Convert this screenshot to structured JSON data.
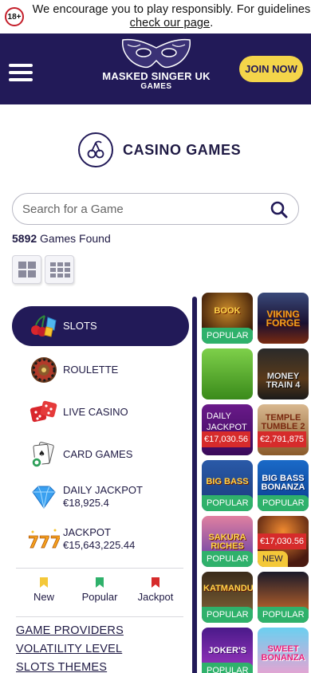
{
  "banner": {
    "age_badge": "18+",
    "text_line1": "We encourage you to play responsibly. For guidelines",
    "link_text": "check our page",
    "suffix": "."
  },
  "header": {
    "menu_icon": "hamburger-icon",
    "brand_line1": "MASKED SINGER UK",
    "brand_line2": "GAMES",
    "join_label": "JOIN NOW"
  },
  "title": {
    "icon": "cherries-icon",
    "text": "CASINO GAMES"
  },
  "search": {
    "placeholder": "Search for a Game",
    "value": "",
    "icon": "search-icon"
  },
  "games_found": {
    "count": "5892",
    "label": "Games Found"
  },
  "view_toggle": {
    "large_grid_icon": "grid-large-icon",
    "small_grid_icon": "grid-small-icon"
  },
  "categories": [
    {
      "label": "SLOTS",
      "icon": "slots-icon",
      "active": true
    },
    {
      "label": "ROULETTE",
      "icon": "roulette-icon",
      "active": false
    },
    {
      "label": "LIVE CASINO",
      "icon": "dice-icon",
      "active": false
    },
    {
      "label": "CARD GAMES",
      "icon": "cards-icon",
      "active": false
    },
    {
      "label": "DAILY JACKPOT",
      "amount": "€18,925.4",
      "icon": "diamond-icon",
      "active": false
    },
    {
      "label": "JACKPOT",
      "amount": "€15,643,225.44",
      "icon": "777-icon",
      "active": false
    }
  ],
  "filters": [
    {
      "label": "New",
      "color": "#f4c839"
    },
    {
      "label": "Popular",
      "color": "#2fb16b"
    },
    {
      "label": "Jackpot",
      "color": "#d62b2b"
    }
  ],
  "links": [
    "GAME PROVIDERS",
    "VOLATILITY LEVEL",
    "SLOTS THEMES"
  ],
  "games": [
    {
      "title": "BOOK",
      "badge": "POPULAR"
    },
    {
      "title": "VIKING FORGE",
      "badge": ""
    },
    {
      "title": "",
      "badge": ""
    },
    {
      "title": "MONEY TRAIN 4",
      "badge": ""
    },
    {
      "title": "DAILY JACKPOT",
      "badge": "",
      "amount": "€17,030.56"
    },
    {
      "title": "TEMPLE TUMBLE 2",
      "badge": "",
      "amount": "€2,791,875"
    },
    {
      "title": "BIG BASS",
      "badge": "POPULAR"
    },
    {
      "title": "BIG BASS BONANZA",
      "badge": "POPULAR"
    },
    {
      "title": "SAKURA RICHES",
      "badge": "POPULAR"
    },
    {
      "title": "",
      "badge": "NEW",
      "amount": "€17,030.56"
    },
    {
      "title": "KATMANDU",
      "badge": "POPULAR"
    },
    {
      "title": "",
      "badge": "POPULAR"
    },
    {
      "title": "JOKER'S",
      "badge": "POPULAR"
    },
    {
      "title": "SWEET BONANZA",
      "badge": ""
    }
  ],
  "colors": {
    "navy": "#221a58",
    "accent_yellow": "#f4d54a",
    "popular_green": "#2fb16b",
    "jackpot_red": "#d62b2b",
    "new_yellow": "#f4c839"
  }
}
